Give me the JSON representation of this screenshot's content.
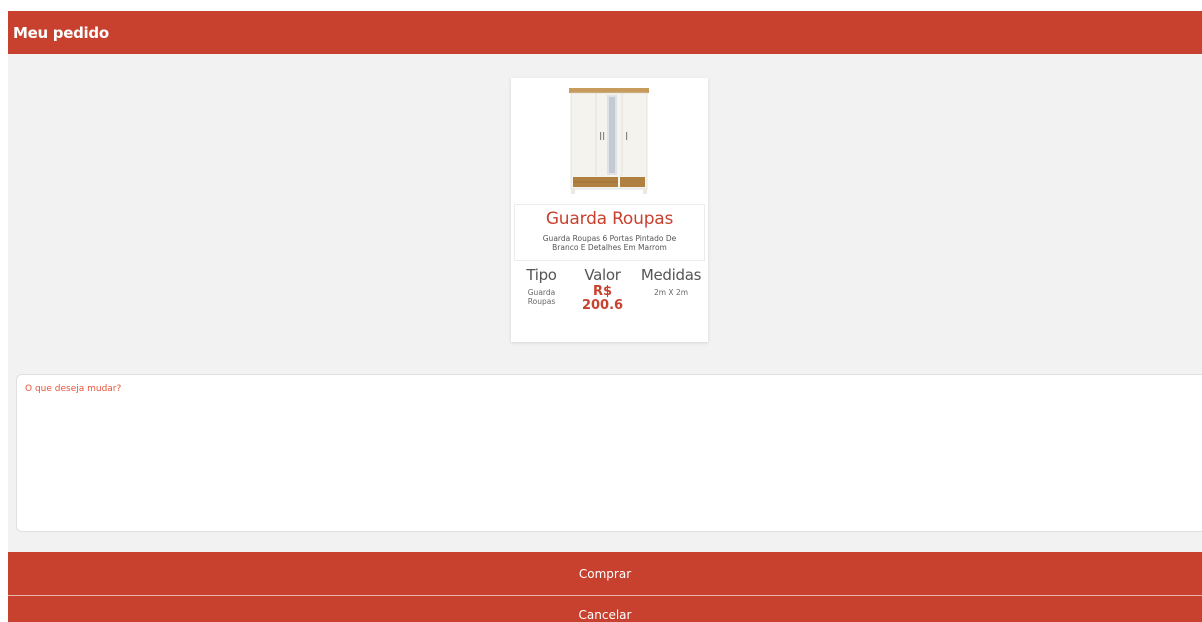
{
  "header": {
    "title": "Meu pedido"
  },
  "product": {
    "image_icon": "wardrobe-image",
    "title": "Guarda Roupas",
    "description": "Guarda Roupas 6 Portas Pintado De Branco E Detalhes Em Marrom",
    "attributes": {
      "tipo_label": "Tipo",
      "tipo_value": "Guarda Roupas",
      "valor_label": "Valor",
      "valor_value": "R$ 200.6",
      "medidas_label": "Medidas",
      "medidas_value": "2m X 2m"
    }
  },
  "change_request": {
    "placeholder": "O que deseja mudar?",
    "value": ""
  },
  "actions": {
    "buy_label": "Comprar",
    "cancel_label": "Cancelar"
  },
  "colors": {
    "accent": "#c8412e",
    "background": "#f2f2f2",
    "placeholder": "#e8543a"
  }
}
